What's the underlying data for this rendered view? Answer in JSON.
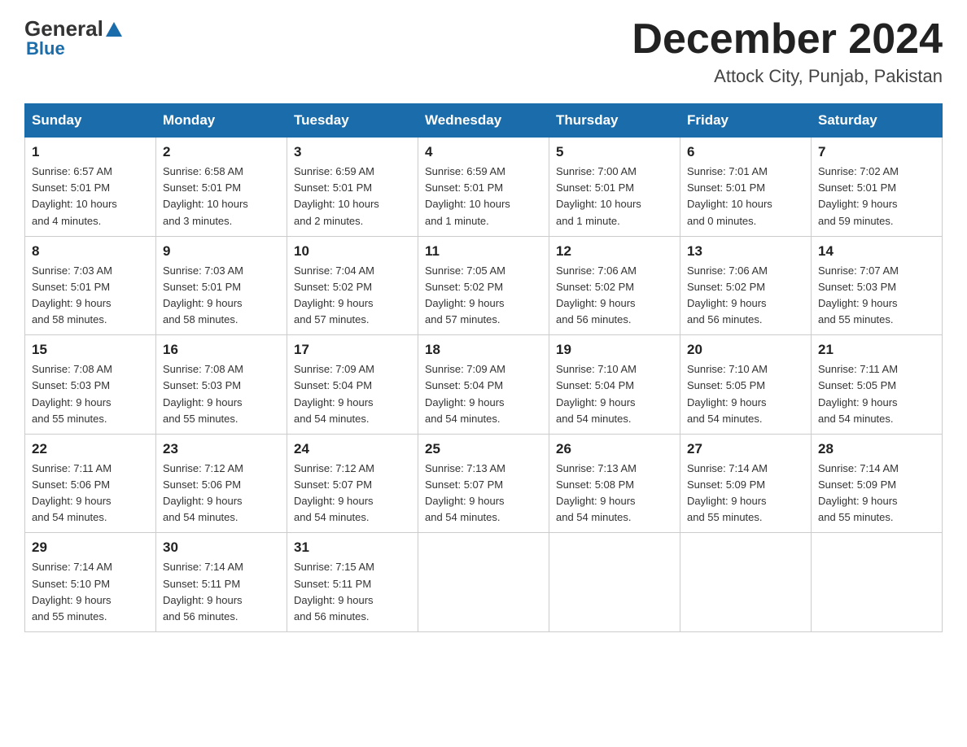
{
  "header": {
    "logo_general": "General",
    "logo_blue": "Blue",
    "month_title": "December 2024",
    "location": "Attock City, Punjab, Pakistan"
  },
  "days_of_week": [
    "Sunday",
    "Monday",
    "Tuesday",
    "Wednesday",
    "Thursday",
    "Friday",
    "Saturday"
  ],
  "weeks": [
    [
      {
        "day": "1",
        "info": "Sunrise: 6:57 AM\nSunset: 5:01 PM\nDaylight: 10 hours\nand 4 minutes."
      },
      {
        "day": "2",
        "info": "Sunrise: 6:58 AM\nSunset: 5:01 PM\nDaylight: 10 hours\nand 3 minutes."
      },
      {
        "day": "3",
        "info": "Sunrise: 6:59 AM\nSunset: 5:01 PM\nDaylight: 10 hours\nand 2 minutes."
      },
      {
        "day": "4",
        "info": "Sunrise: 6:59 AM\nSunset: 5:01 PM\nDaylight: 10 hours\nand 1 minute."
      },
      {
        "day": "5",
        "info": "Sunrise: 7:00 AM\nSunset: 5:01 PM\nDaylight: 10 hours\nand 1 minute."
      },
      {
        "day": "6",
        "info": "Sunrise: 7:01 AM\nSunset: 5:01 PM\nDaylight: 10 hours\nand 0 minutes."
      },
      {
        "day": "7",
        "info": "Sunrise: 7:02 AM\nSunset: 5:01 PM\nDaylight: 9 hours\nand 59 minutes."
      }
    ],
    [
      {
        "day": "8",
        "info": "Sunrise: 7:03 AM\nSunset: 5:01 PM\nDaylight: 9 hours\nand 58 minutes."
      },
      {
        "day": "9",
        "info": "Sunrise: 7:03 AM\nSunset: 5:01 PM\nDaylight: 9 hours\nand 58 minutes."
      },
      {
        "day": "10",
        "info": "Sunrise: 7:04 AM\nSunset: 5:02 PM\nDaylight: 9 hours\nand 57 minutes."
      },
      {
        "day": "11",
        "info": "Sunrise: 7:05 AM\nSunset: 5:02 PM\nDaylight: 9 hours\nand 57 minutes."
      },
      {
        "day": "12",
        "info": "Sunrise: 7:06 AM\nSunset: 5:02 PM\nDaylight: 9 hours\nand 56 minutes."
      },
      {
        "day": "13",
        "info": "Sunrise: 7:06 AM\nSunset: 5:02 PM\nDaylight: 9 hours\nand 56 minutes."
      },
      {
        "day": "14",
        "info": "Sunrise: 7:07 AM\nSunset: 5:03 PM\nDaylight: 9 hours\nand 55 minutes."
      }
    ],
    [
      {
        "day": "15",
        "info": "Sunrise: 7:08 AM\nSunset: 5:03 PM\nDaylight: 9 hours\nand 55 minutes."
      },
      {
        "day": "16",
        "info": "Sunrise: 7:08 AM\nSunset: 5:03 PM\nDaylight: 9 hours\nand 55 minutes."
      },
      {
        "day": "17",
        "info": "Sunrise: 7:09 AM\nSunset: 5:04 PM\nDaylight: 9 hours\nand 54 minutes."
      },
      {
        "day": "18",
        "info": "Sunrise: 7:09 AM\nSunset: 5:04 PM\nDaylight: 9 hours\nand 54 minutes."
      },
      {
        "day": "19",
        "info": "Sunrise: 7:10 AM\nSunset: 5:04 PM\nDaylight: 9 hours\nand 54 minutes."
      },
      {
        "day": "20",
        "info": "Sunrise: 7:10 AM\nSunset: 5:05 PM\nDaylight: 9 hours\nand 54 minutes."
      },
      {
        "day": "21",
        "info": "Sunrise: 7:11 AM\nSunset: 5:05 PM\nDaylight: 9 hours\nand 54 minutes."
      }
    ],
    [
      {
        "day": "22",
        "info": "Sunrise: 7:11 AM\nSunset: 5:06 PM\nDaylight: 9 hours\nand 54 minutes."
      },
      {
        "day": "23",
        "info": "Sunrise: 7:12 AM\nSunset: 5:06 PM\nDaylight: 9 hours\nand 54 minutes."
      },
      {
        "day": "24",
        "info": "Sunrise: 7:12 AM\nSunset: 5:07 PM\nDaylight: 9 hours\nand 54 minutes."
      },
      {
        "day": "25",
        "info": "Sunrise: 7:13 AM\nSunset: 5:07 PM\nDaylight: 9 hours\nand 54 minutes."
      },
      {
        "day": "26",
        "info": "Sunrise: 7:13 AM\nSunset: 5:08 PM\nDaylight: 9 hours\nand 54 minutes."
      },
      {
        "day": "27",
        "info": "Sunrise: 7:14 AM\nSunset: 5:09 PM\nDaylight: 9 hours\nand 55 minutes."
      },
      {
        "day": "28",
        "info": "Sunrise: 7:14 AM\nSunset: 5:09 PM\nDaylight: 9 hours\nand 55 minutes."
      }
    ],
    [
      {
        "day": "29",
        "info": "Sunrise: 7:14 AM\nSunset: 5:10 PM\nDaylight: 9 hours\nand 55 minutes."
      },
      {
        "day": "30",
        "info": "Sunrise: 7:14 AM\nSunset: 5:11 PM\nDaylight: 9 hours\nand 56 minutes."
      },
      {
        "day": "31",
        "info": "Sunrise: 7:15 AM\nSunset: 5:11 PM\nDaylight: 9 hours\nand 56 minutes."
      },
      null,
      null,
      null,
      null
    ]
  ]
}
